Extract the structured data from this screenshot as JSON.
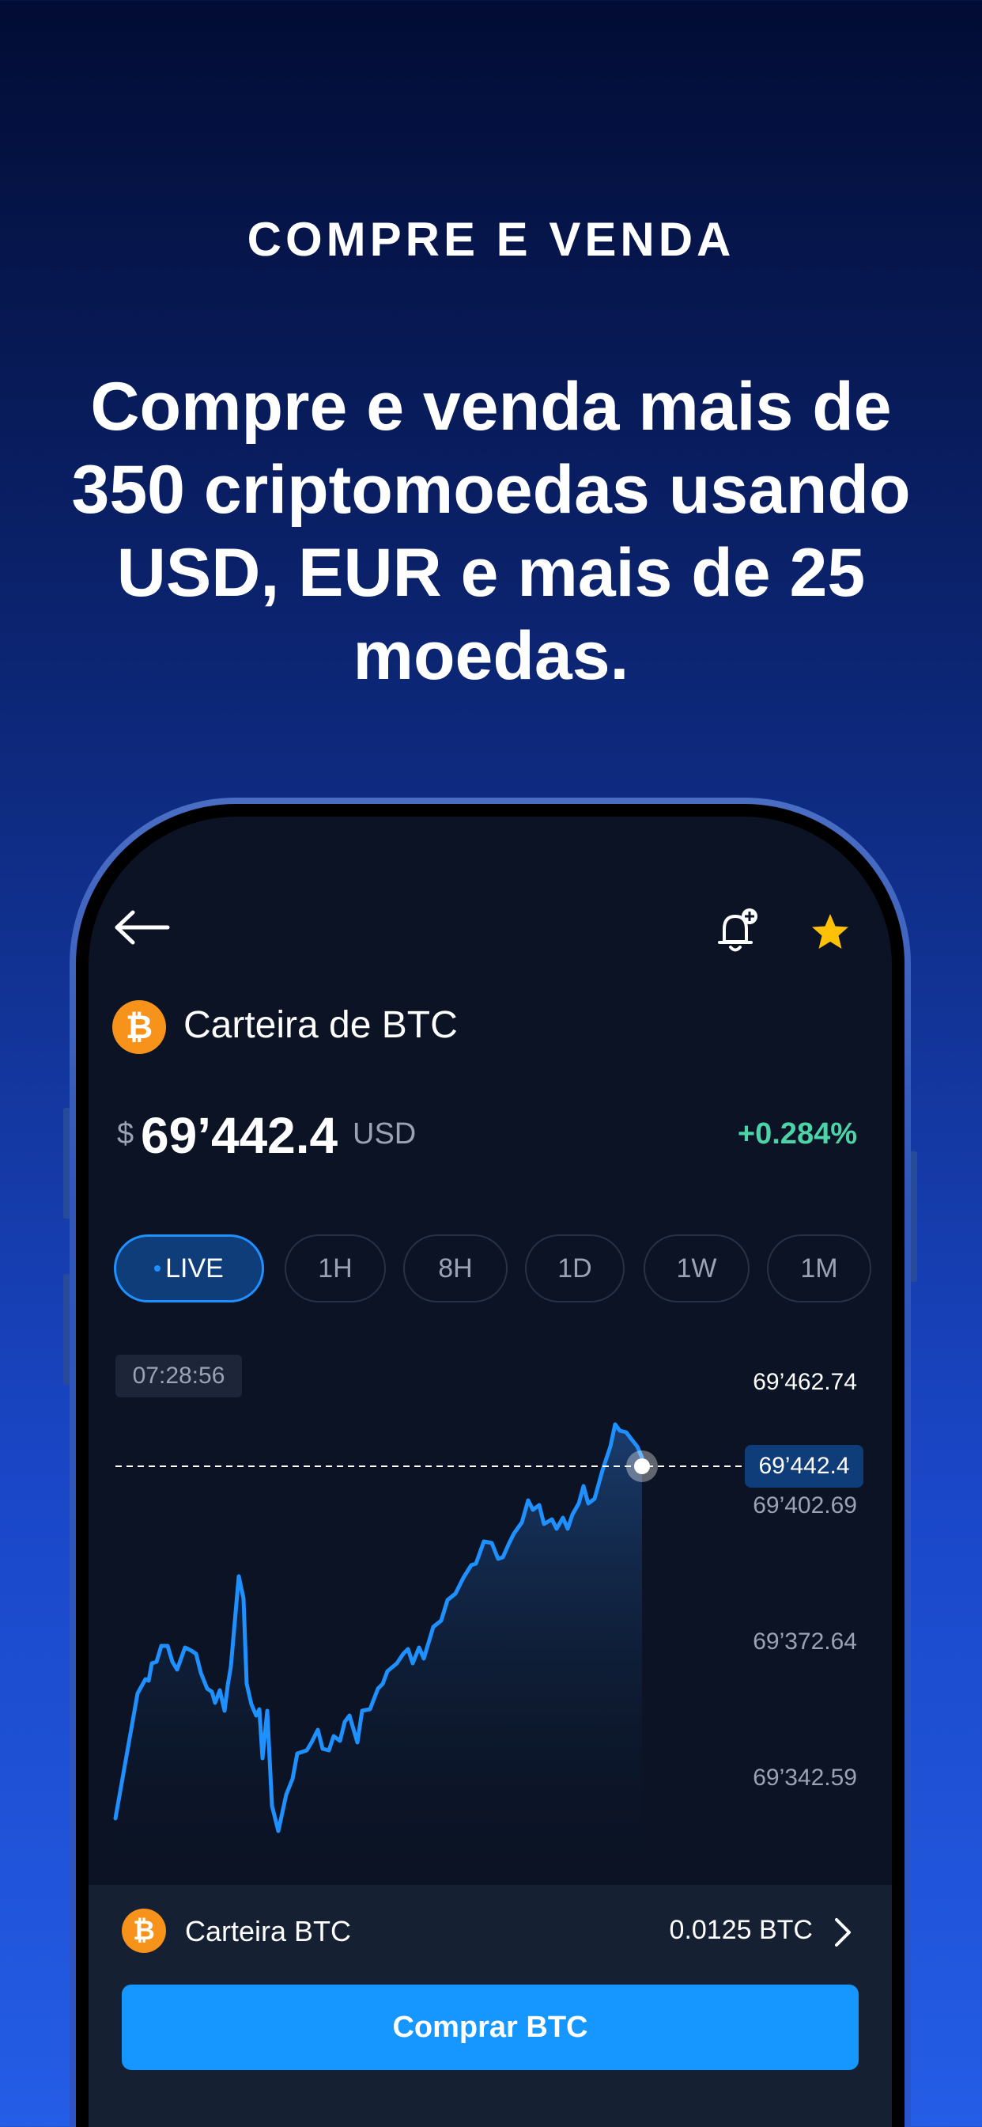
{
  "page": {
    "eyebrow": "COMPRE E VENDA",
    "headline": "Compre e venda mais de 350 criptomoedas usando USD, EUR e mais de 25 moedas."
  },
  "app": {
    "wallet_title": "Carteira de BTC",
    "currency_sign": "$",
    "price": "69’442.4",
    "price_unit": "USD",
    "change": "+0.284%",
    "ranges": [
      "LIVE",
      "1H",
      "8H",
      "1D",
      "1W",
      "1M"
    ],
    "active_range": "LIVE",
    "time": "07:28:56",
    "y_labels": [
      "69’462.74",
      "69’402.69",
      "69’372.64",
      "69’342.59"
    ],
    "current_tag": "69’442.4",
    "wallet_label": "Carteira BTC",
    "wallet_balance": "0.0125 BTC",
    "buy_label": "Comprar BTC",
    "coin_glyph": "₿"
  },
  "colors": {
    "accent": "#1597ff",
    "positive": "#4cd4a8",
    "bitcoin": "#f7931a",
    "star": "#ffc107"
  },
  "icons": [
    "back-arrow-icon",
    "bell-plus-icon",
    "star-icon",
    "bitcoin-icon",
    "chevron-right-icon"
  ]
}
